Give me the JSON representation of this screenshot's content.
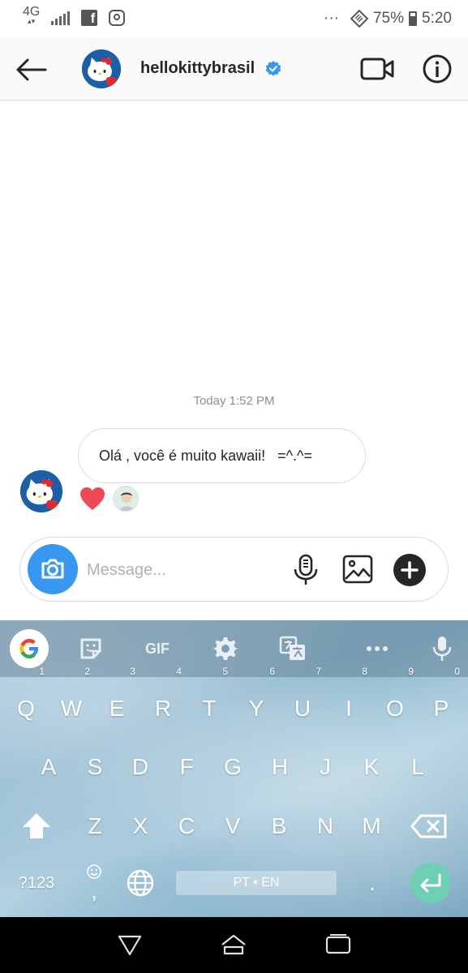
{
  "status_bar": {
    "network": "4G",
    "battery_percent": "75%",
    "time": "5:20",
    "more": "···",
    "notification_icons": [
      "facebook-icon",
      "instagram-icon"
    ]
  },
  "header": {
    "username": "hellokittybrasil",
    "verified": true
  },
  "thread": {
    "timestamp": "Today 1:52 PM",
    "message": "Olá , você é muito kawaii!   =^.^=",
    "reaction": "heart"
  },
  "composer": {
    "placeholder": "Message..."
  },
  "keyboard": {
    "toolbar": {
      "gif_label": "GIF"
    },
    "rows": [
      [
        {
          "k": "Q",
          "n": "1"
        },
        {
          "k": "W",
          "n": "2"
        },
        {
          "k": "E",
          "n": "3"
        },
        {
          "k": "R",
          "n": "4"
        },
        {
          "k": "T",
          "n": "5"
        },
        {
          "k": "Y",
          "n": "6"
        },
        {
          "k": "U",
          "n": "7"
        },
        {
          "k": "I",
          "n": "8"
        },
        {
          "k": "O",
          "n": "9"
        },
        {
          "k": "P",
          "n": "0"
        }
      ],
      [
        {
          "k": "A"
        },
        {
          "k": "S"
        },
        {
          "k": "D"
        },
        {
          "k": "F"
        },
        {
          "k": "G"
        },
        {
          "k": "H"
        },
        {
          "k": "J"
        },
        {
          "k": "K"
        },
        {
          "k": "L"
        }
      ],
      [
        {
          "k": "Z"
        },
        {
          "k": "X"
        },
        {
          "k": "C"
        },
        {
          "k": "V"
        },
        {
          "k": "B"
        },
        {
          "k": "N"
        },
        {
          "k": "M"
        }
      ]
    ],
    "symbols_key": "?123",
    "emoji_comma_key": ",",
    "space_label": "PT • EN",
    "period_key": "."
  },
  "colors": {
    "accent_blue": "#3897f0",
    "verified_blue": "#3897f0",
    "heart_red": "#ed4956",
    "enter_green": "#6fcfb4"
  }
}
